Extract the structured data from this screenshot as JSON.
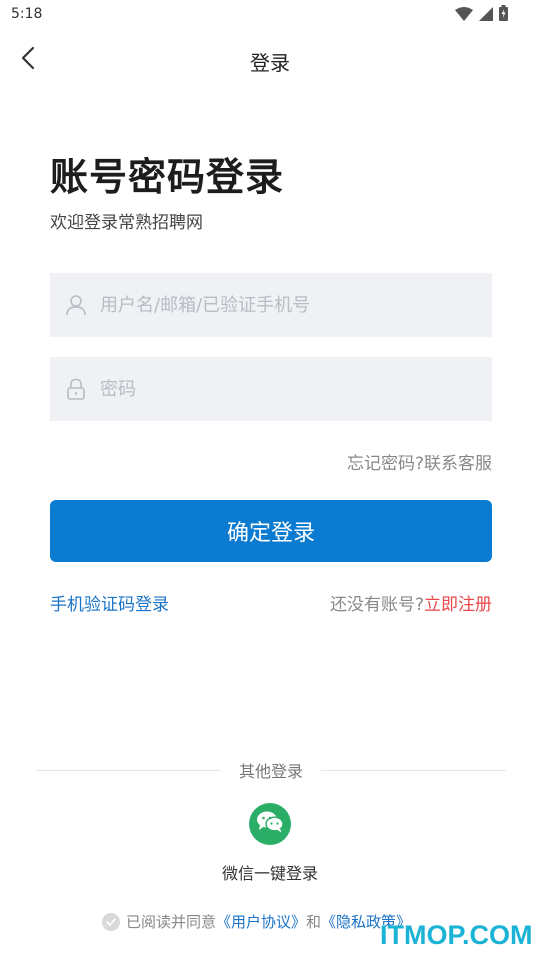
{
  "status_bar": {
    "time": "5:18"
  },
  "nav": {
    "title": "登录"
  },
  "heading": "账号密码登录",
  "subheading": "欢迎登录常熟招聘网",
  "form": {
    "username_placeholder": "用户名/邮箱/已验证手机号",
    "password_placeholder": "密码",
    "forgot_label": "忘记密码?",
    "contact_label": "联系客服",
    "submit_label": "确定登录"
  },
  "links": {
    "sms_login": "手机验证码登录",
    "no_account": "还没有账号?",
    "register": "立即注册"
  },
  "other_login": {
    "divider_label": "其他登录",
    "wechat_label": "微信一键登录",
    "wechat_icon": "wechat-icon"
  },
  "agreement": {
    "prefix": "已阅读并同意",
    "user_agreement": "《用户协议》",
    "and": "和",
    "privacy_policy": "《隐私政策》"
  },
  "watermark": "ITMOP.COM",
  "colors": {
    "primary": "#0a7bd0",
    "link": "#1a73c8",
    "register": "#e9474b",
    "wechat": "#2aae67",
    "field_bg": "#eff1f5"
  }
}
